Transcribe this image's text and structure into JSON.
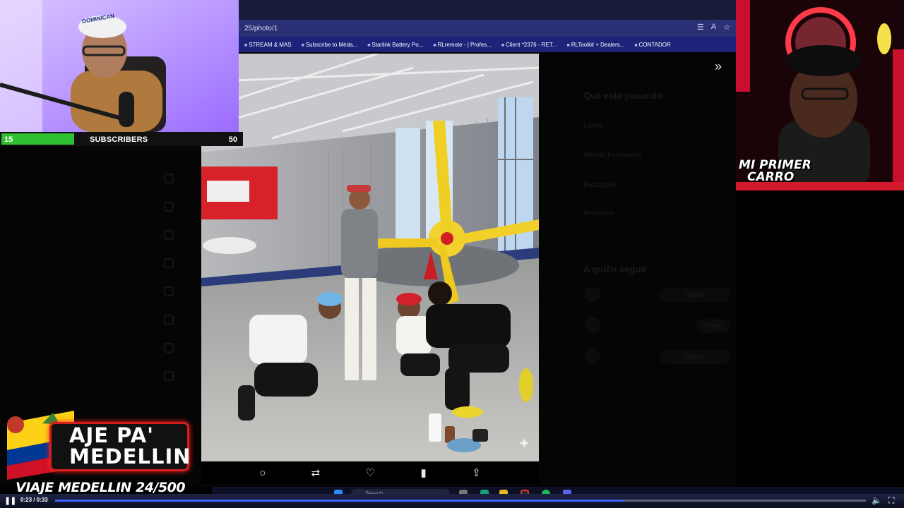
{
  "browser": {
    "url_fragment": "25/photo/1",
    "bookmarks": [
      "STREAM & MAS",
      "Subscribe to Méda...",
      "Starlink Battery Po...",
      "RLremote - | Profes...",
      "Client *2376 - RET...",
      "RLToolkit + Dealers...",
      "CONTADOR"
    ]
  },
  "webcam_left": {
    "cap_text": "DOMINICAN"
  },
  "subscriber_goal": {
    "current": "15",
    "label": "SUBSCRIBERS",
    "target": "50",
    "fill_fraction": 0.3
  },
  "webcam_right": {
    "overlay_line1": "MI PRIMER",
    "overlay_line2": "CARRO"
  },
  "post_actions": {
    "reply_icon": "reply-icon",
    "repost_icon": "repost-icon",
    "like_icon": "heart-icon",
    "views_icon": "analytics-icon",
    "share_icon": "share-icon"
  },
  "right_pane": {
    "heading": "Qué está pasando",
    "items": [
      "Lorem",
      "Alberto Fernández",
      "Redcoque",
      "Mercedes"
    ],
    "follow_heading": "A quién seguir",
    "follow_buttons": [
      "Seguir",
      "Seguir",
      "Seguir"
    ]
  },
  "banner": {
    "line1": "AJE PA'",
    "line2": "MEDELLIN",
    "ticker": "VIAJE MEDELLIN 24/500"
  },
  "taskbar": {
    "search_placeholder": "Search"
  },
  "player": {
    "time": "0:23 / 0:33",
    "progress_fraction": 0.7
  },
  "colors": {
    "goal_fill": "#2fc12f",
    "banner_border": "#d61d1d",
    "progress": "#3a66ff",
    "address_bar": "#2b2f73"
  }
}
